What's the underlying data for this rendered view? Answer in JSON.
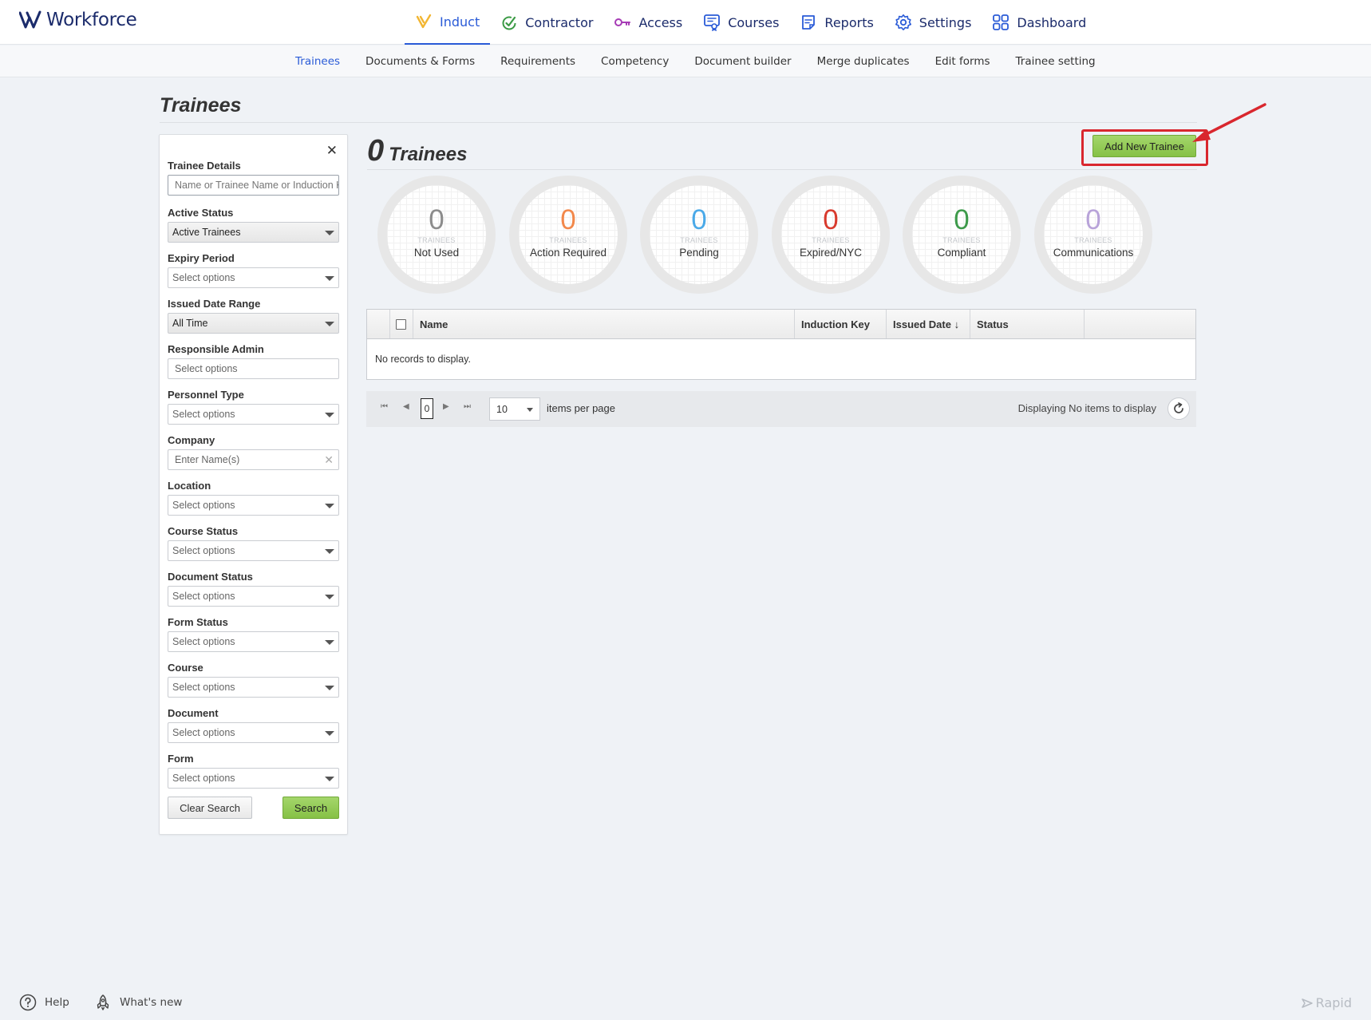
{
  "app": {
    "name": "Workforce"
  },
  "nav": {
    "items": [
      {
        "label": "Induct",
        "icon": "induct-icon",
        "active": true
      },
      {
        "label": "Contractor",
        "icon": "contractor-check-icon"
      },
      {
        "label": "Access",
        "icon": "key-icon"
      },
      {
        "label": "Courses",
        "icon": "courses-icon"
      },
      {
        "label": "Reports",
        "icon": "reports-icon"
      },
      {
        "label": "Settings",
        "icon": "gear-icon"
      },
      {
        "label": "Dashboard",
        "icon": "dashboard-icon"
      }
    ]
  },
  "subnav": {
    "items": [
      {
        "label": "Trainees",
        "active": true
      },
      {
        "label": "Documents & Forms"
      },
      {
        "label": "Requirements"
      },
      {
        "label": "Competency"
      },
      {
        "label": "Document builder"
      },
      {
        "label": "Merge duplicates"
      },
      {
        "label": "Edit forms"
      },
      {
        "label": "Trainee setting"
      }
    ]
  },
  "page": {
    "title": "Trainees"
  },
  "filters": {
    "close": "✕",
    "trainee_details": {
      "label": "Trainee Details",
      "placeholder": "Name or Trainee Name or Induction Key"
    },
    "active_status": {
      "label": "Active Status",
      "value": "Active Trainees"
    },
    "expiry_period": {
      "label": "Expiry Period",
      "value": "Select options"
    },
    "issued_date_range": {
      "label": "Issued Date Range",
      "value": "All Time"
    },
    "responsible_admin": {
      "label": "Responsible Admin",
      "value": "Select options"
    },
    "personnel_type": {
      "label": "Personnel Type",
      "value": "Select options"
    },
    "company": {
      "label": "Company",
      "value": "Enter Name(s)"
    },
    "location": {
      "label": "Location",
      "value": "Select options"
    },
    "course_status": {
      "label": "Course Status",
      "value": "Select options"
    },
    "document_status": {
      "label": "Document Status",
      "value": "Select options"
    },
    "form_status": {
      "label": "Form Status",
      "value": "Select options"
    },
    "course": {
      "label": "Course",
      "value": "Select options"
    },
    "document": {
      "label": "Document",
      "value": "Select options"
    },
    "form": {
      "label": "Form",
      "value": "Select options"
    },
    "clear_label": "Clear Search",
    "search_label": "Search"
  },
  "summary": {
    "count": "0",
    "label": "Trainees",
    "add_label": "Add New Trainee"
  },
  "stats": [
    {
      "value": "0",
      "sub": "TRAINEES",
      "label": "Not Used",
      "color": "#8c8c8c"
    },
    {
      "value": "0",
      "sub": "TRAINEES",
      "label": "Action Required",
      "color": "#f2884b"
    },
    {
      "value": "0",
      "sub": "TRAINEES",
      "label": "Pending",
      "color": "#4aa9e8"
    },
    {
      "value": "0",
      "sub": "TRAINEES",
      "label": "Expired/NYC",
      "color": "#d83a2d"
    },
    {
      "value": "0",
      "sub": "TRAINEES",
      "label": "Compliant",
      "color": "#3d9a4a"
    },
    {
      "value": "0",
      "sub": "TRAINEES",
      "label": "Communications",
      "color": "#b8a3d9"
    }
  ],
  "grid": {
    "columns": [
      "Name",
      "Induction Key",
      "Issued Date ↓",
      "Status"
    ],
    "empty": "No records to display."
  },
  "pager": {
    "page": "0",
    "page_size": "10",
    "per_page_label": "items per page",
    "display": "Displaying No items to display"
  },
  "footer": {
    "help": "Help",
    "whats_new": "What's new",
    "brand": "Rapid"
  }
}
